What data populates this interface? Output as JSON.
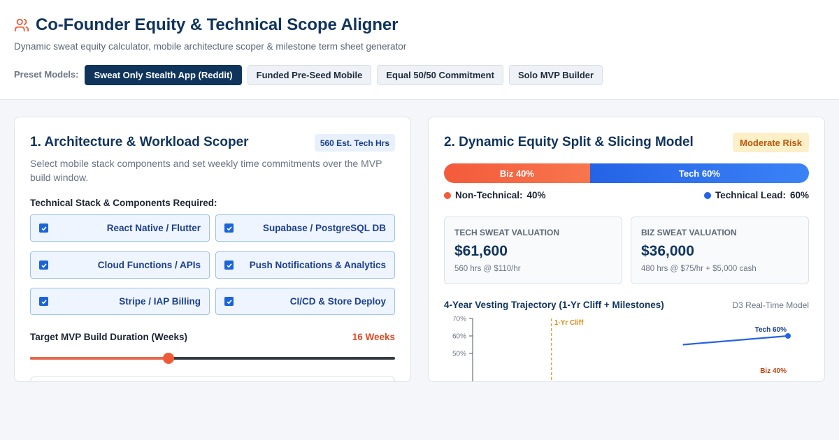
{
  "header": {
    "title": "Co-Founder Equity & Technical Scope Aligner",
    "subtitle": "Dynamic sweat equity calculator, mobile architecture scoper & milestone term sheet generator",
    "preset_label": "Preset Models:",
    "presets": [
      {
        "label": "Sweat Only Stealth App (Reddit)",
        "active": true
      },
      {
        "label": "Funded Pre-Seed Mobile",
        "active": false
      },
      {
        "label": "Equal 50/50 Commitment",
        "active": false
      },
      {
        "label": "Solo MVP Builder",
        "active": false
      }
    ],
    "icon": "users-icon"
  },
  "scoper": {
    "title": "1. Architecture & Workload Scoper",
    "hours_badge": "560 Est. Tech Hrs",
    "description": "Select mobile stack components and set weekly time commitments over the MVP build window.",
    "stack_label": "Technical Stack & Components Required:",
    "components": [
      {
        "label": "React Native / Flutter",
        "checked": true
      },
      {
        "label": "Supabase / PostgreSQL DB",
        "checked": true
      },
      {
        "label": "Cloud Functions / APIs",
        "checked": true
      },
      {
        "label": "Push Notifications & Analytics",
        "checked": true
      },
      {
        "label": "Stripe / IAP Billing",
        "checked": true
      },
      {
        "label": "CI/CD & Store Deploy",
        "checked": true
      }
    ],
    "duration_label": "Target MVP Build Duration (Weeks)",
    "duration_value": "16 Weeks",
    "duration_fraction": 0.38
  },
  "equity": {
    "title": "2. Dynamic Equity Split & Slicing Model",
    "risk_badge": "Moderate Risk",
    "biz_bar_label": "Biz 40%",
    "tech_bar_label": "Tech 60%",
    "biz_fraction": 0.4,
    "non_tech_label": "Non-Technical:",
    "non_tech_pct": "40%",
    "tech_lead_label": "Technical Lead:",
    "tech_lead_pct": "60%",
    "tech_card": {
      "title": "Tech Sweat Valuation",
      "value": "$61,600",
      "detail": "560 hrs @ $110/hr"
    },
    "biz_card": {
      "title": "Biz Sweat Valuation",
      "value": "$36,000",
      "detail": "480 hrs @ $75/hr + $5,000 cash"
    },
    "vesting_title": "4-Year Vesting Trajectory (1-Yr Cliff + Milestones)",
    "vesting_tag": "D3 Real-Time Model",
    "colors": {
      "biz": "#f45a3b",
      "tech": "#2563e6",
      "cliff": "#e8a23a"
    }
  },
  "chart_data": {
    "type": "line",
    "title": "4-Year Vesting Trajectory (1-Yr Cliff + Milestones)",
    "y_ticks": [
      "70%",
      "60%",
      "50%"
    ],
    "ylim": [
      0,
      70
    ],
    "xlim": [
      0,
      48
    ],
    "annotations": [
      {
        "label": "1-Yr Cliff",
        "x": 12
      }
    ],
    "series": [
      {
        "name": "Tech 60%",
        "points": [
          [
            32,
            55
          ],
          [
            48,
            60
          ]
        ]
      },
      {
        "name": "Biz 40%",
        "points": [
          [
            48,
            40
          ]
        ]
      }
    ]
  }
}
